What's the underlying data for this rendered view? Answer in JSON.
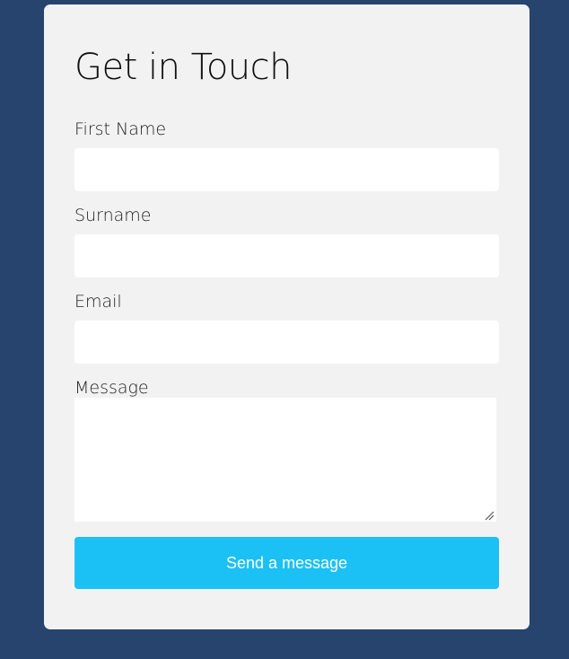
{
  "form": {
    "title": "Get in Touch",
    "fields": [
      {
        "label": "First Name",
        "value": "",
        "placeholder": ""
      },
      {
        "label": "Surname",
        "value": "",
        "placeholder": ""
      },
      {
        "label": "Email",
        "value": "",
        "placeholder": ""
      },
      {
        "label": "Message",
        "value": "",
        "placeholder": ""
      }
    ],
    "submit_label": "Send a message"
  },
  "colors": {
    "background": "#27446f",
    "card": "#f2f2f2",
    "input": "#ffffff",
    "accent": "#1bc1f4",
    "button_text": "#ffffff"
  },
  "icons": {
    "textarea_resize": "resize-grip-icon"
  }
}
